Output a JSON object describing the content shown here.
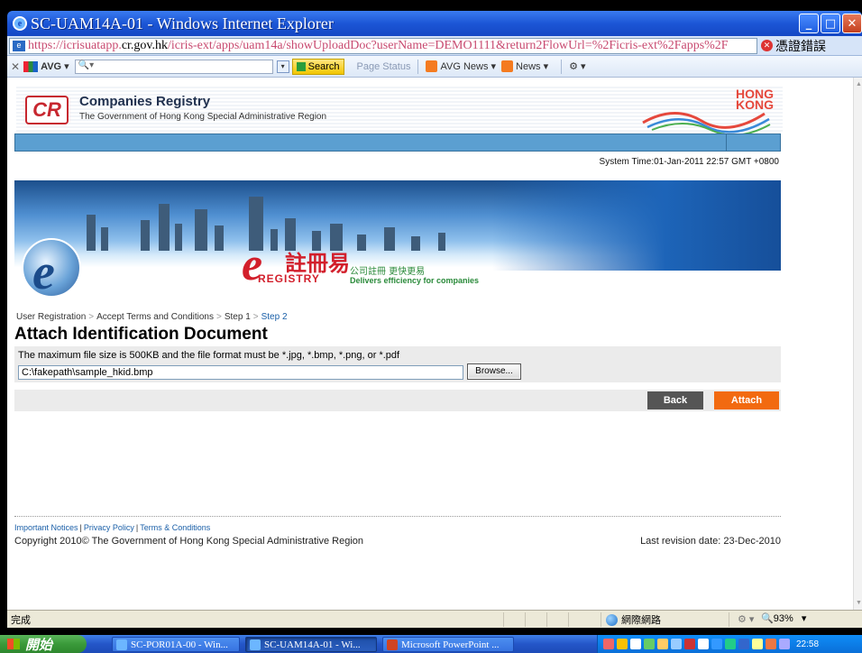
{
  "window": {
    "title": "SC-UAM14A-01 - Windows Internet Explorer",
    "url_prefix": "https://icrisuatapp.",
    "url_domain": "cr.gov.hk",
    "url_suffix": "/icris-ext/apps/uam14a/showUploadDoc?userName=DEMO1111&return2FlowUrl=%2Ficris-ext%2Fapps%2F",
    "cert_error": "憑證錯誤"
  },
  "toolbar": {
    "avg_label": "AVG",
    "search_label": "Search",
    "page_status": "Page Status",
    "avg_news": "AVG News",
    "news": "News"
  },
  "header": {
    "org_logo": "CR",
    "org_name": "Companies Registry",
    "org_sub": "The Government of Hong Kong Special Administrative Region",
    "hk_logo_line1": "HONG",
    "hk_logo_line2": "KONG"
  },
  "system_time": "System Time:01-Jan-2011 22:57 GMT +0800",
  "banner": {
    "brand_e": "e",
    "brand_zh": "註冊易",
    "brand_en": "REGISTRY",
    "tagline_zh": "公司註冊 更快更易",
    "tagline_en": "Delivers efficiency for companies"
  },
  "breadcrumb": [
    {
      "label": "User Registration",
      "current": false
    },
    {
      "label": "Accept Terms and Conditions",
      "current": false
    },
    {
      "label": "Step 1",
      "current": false
    },
    {
      "label": "Step 2",
      "current": true
    }
  ],
  "breadcrumb_sep": ">",
  "page_title": "Attach Identification Document",
  "upload": {
    "note": "The maximum file size is 500KB and the file format must be *.jpg, *.bmp, *.png, or *.pdf",
    "file_value": "C:\\fakepath\\sample_hkid.bmp",
    "browse_label": "Browse..."
  },
  "actions": {
    "back": "Back",
    "attach": "Attach"
  },
  "footer": {
    "links": [
      "Important Notices",
      "Privacy Policy",
      "Terms & Conditions"
    ],
    "copyright": "Copyright 2010© The Government of Hong Kong Special Administrative Region",
    "last_revision": "Last revision date: 23-Dec-2010"
  },
  "statusbar": {
    "done": "完成",
    "zone": "網際網路",
    "zoom": "93%"
  },
  "taskbar": {
    "start": "開始",
    "tasks": [
      {
        "label": "SC-POR01A-00 - Win...",
        "active": false
      },
      {
        "label": "SC-UAM14A-01 - Wi...",
        "active": true
      },
      {
        "label": "Microsoft PowerPoint ...",
        "active": false
      }
    ],
    "clock": "22:58"
  },
  "colors": {
    "accent_orange": "#f26a10",
    "back_gray": "#555555",
    "link_blue": "#1a5fa8",
    "bar_blue": "#5b9fd1"
  }
}
